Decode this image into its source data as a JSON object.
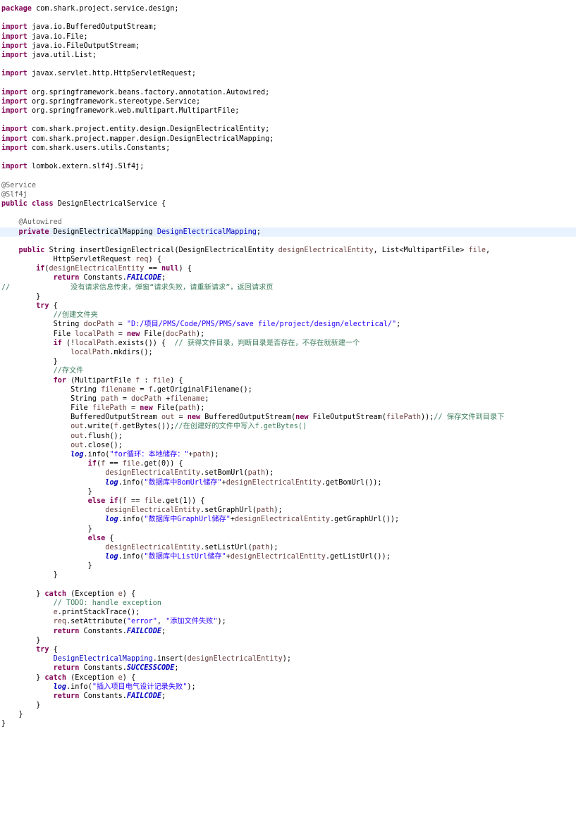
{
  "editor": {
    "language": "java",
    "highlighted_line": 24,
    "colors": {
      "background": "#ffffff",
      "line_highlight": "#e8f2fe",
      "keyword": "#7f0055",
      "annotation": "#646464",
      "comment": "#3f7f5f",
      "string": "#2a00ff",
      "field": "#0000c0",
      "variable": "#6a3e3e"
    },
    "lines": [
      [
        [
          "kw",
          "package"
        ],
        [
          "pl",
          " com.shark.project.service.design;"
        ]
      ],
      [],
      [
        [
          "kw",
          "import"
        ],
        [
          "pl",
          " java.io.BufferedOutputStream;"
        ]
      ],
      [
        [
          "kw",
          "import"
        ],
        [
          "pl",
          " java.io.File;"
        ]
      ],
      [
        [
          "kw",
          "import"
        ],
        [
          "pl",
          " java.io.FileOutputStream;"
        ]
      ],
      [
        [
          "kw",
          "import"
        ],
        [
          "pl",
          " java.util.List;"
        ]
      ],
      [],
      [
        [
          "kw",
          "import"
        ],
        [
          "pl",
          " javax.servlet.http.HttpServletRequest;"
        ]
      ],
      [],
      [
        [
          "kw",
          "import"
        ],
        [
          "pl",
          " org.springframework.beans.factory.annotation.Autowired;"
        ]
      ],
      [
        [
          "kw",
          "import"
        ],
        [
          "pl",
          " org.springframework.stereotype.Service;"
        ]
      ],
      [
        [
          "kw",
          "import"
        ],
        [
          "pl",
          " org.springframework.web.multipart.MultipartFile;"
        ]
      ],
      [],
      [
        [
          "kw",
          "import"
        ],
        [
          "pl",
          " com.shark.project.entity.design.DesignElectricalEntity;"
        ]
      ],
      [
        [
          "kw",
          "import"
        ],
        [
          "pl",
          " com.shark.project.mapper.design.DesignElectricalMapping;"
        ]
      ],
      [
        [
          "kw",
          "import"
        ],
        [
          "pl",
          " com.shark.users.utils.Constants;"
        ]
      ],
      [],
      [
        [
          "kw",
          "import"
        ],
        [
          "pl",
          " lombok.extern.slf4j.Slf4j;"
        ]
      ],
      [],
      [
        [
          "an",
          "@Service"
        ]
      ],
      [
        [
          "an",
          "@Slf4j"
        ]
      ],
      [
        [
          "kw",
          "public"
        ],
        [
          "pl",
          " "
        ],
        [
          "kw",
          "class"
        ],
        [
          "pl",
          " DesignElectricalService {"
        ]
      ],
      [],
      [
        [
          "pl",
          "    "
        ],
        [
          "an",
          "@Autowired"
        ]
      ],
      [
        [
          "pl",
          "    "
        ],
        [
          "kw",
          "private"
        ],
        [
          "pl",
          " DesignElectricalMapping "
        ],
        [
          "fd",
          "DesignElectricalMapping"
        ],
        [
          "pl",
          ";"
        ]
      ],
      [],
      [
        [
          "pl",
          "    "
        ],
        [
          "kw",
          "public"
        ],
        [
          "pl",
          " String insertDesignElectrical(DesignElectricalEntity "
        ],
        [
          "vr",
          "designElectricalEntity"
        ],
        [
          "pl",
          ", List<MultipartFile> "
        ],
        [
          "vr",
          "file"
        ],
        [
          "pl",
          ","
        ]
      ],
      [
        [
          "pl",
          "            HttpServletRequest "
        ],
        [
          "vr",
          "req"
        ],
        [
          "pl",
          ") {"
        ]
      ],
      [
        [
          "pl",
          "        "
        ],
        [
          "kw",
          "if"
        ],
        [
          "pl",
          "("
        ],
        [
          "vr",
          "designElectricalEntity"
        ],
        [
          "pl",
          " == "
        ],
        [
          "kw",
          "null"
        ],
        [
          "pl",
          ") {"
        ]
      ],
      [
        [
          "pl",
          "            "
        ],
        [
          "kw",
          "return"
        ],
        [
          "pl",
          " Constants."
        ],
        [
          "sf",
          "FAILCODE"
        ],
        [
          "pl",
          ";"
        ]
      ],
      [
        [
          "cm",
          "//              没有请求信息传来，弹窗“请求失败，请重新请求”，返回请求页"
        ]
      ],
      [
        [
          "pl",
          "        }"
        ]
      ],
      [
        [
          "pl",
          "        "
        ],
        [
          "kw",
          "try"
        ],
        [
          "pl",
          " {"
        ]
      ],
      [
        [
          "pl",
          "            "
        ],
        [
          "cm",
          "//创建文件夹"
        ]
      ],
      [
        [
          "pl",
          "            String "
        ],
        [
          "vr",
          "docPath"
        ],
        [
          "pl",
          " = "
        ],
        [
          "st",
          "\"D:/项目/PMS/Code/PMS/PMS/save file/project/design/electrical/\""
        ],
        [
          "pl",
          ";"
        ]
      ],
      [
        [
          "pl",
          "            File "
        ],
        [
          "vr",
          "localPath"
        ],
        [
          "pl",
          " = "
        ],
        [
          "kw",
          "new"
        ],
        [
          "pl",
          " File("
        ],
        [
          "vr",
          "docPath"
        ],
        [
          "pl",
          ");"
        ]
      ],
      [
        [
          "pl",
          "            "
        ],
        [
          "kw",
          "if"
        ],
        [
          "pl",
          " (!"
        ],
        [
          "vr",
          "localPath"
        ],
        [
          "pl",
          ".exists()) {  "
        ],
        [
          "cm",
          "// 获得文件目录，判断目录是否存在，不存在就新建一个"
        ]
      ],
      [
        [
          "pl",
          "                "
        ],
        [
          "vr",
          "localPath"
        ],
        [
          "pl",
          ".mkdirs();"
        ]
      ],
      [
        [
          "pl",
          "            }"
        ]
      ],
      [
        [
          "pl",
          "            "
        ],
        [
          "cm",
          "//存文件"
        ]
      ],
      [
        [
          "pl",
          "            "
        ],
        [
          "kw",
          "for"
        ],
        [
          "pl",
          " (MultipartFile "
        ],
        [
          "vr",
          "f"
        ],
        [
          "pl",
          " : "
        ],
        [
          "vr",
          "file"
        ],
        [
          "pl",
          ") {"
        ]
      ],
      [
        [
          "pl",
          "                String "
        ],
        [
          "vr",
          "filename"
        ],
        [
          "pl",
          " = "
        ],
        [
          "vr",
          "f"
        ],
        [
          "pl",
          ".getOriginalFilename();"
        ]
      ],
      [
        [
          "pl",
          "                String "
        ],
        [
          "vr",
          "path"
        ],
        [
          "pl",
          " = "
        ],
        [
          "vr",
          "docPath"
        ],
        [
          "pl",
          " +"
        ],
        [
          "vr",
          "filename"
        ],
        [
          "pl",
          ";"
        ]
      ],
      [
        [
          "pl",
          "                File "
        ],
        [
          "vr",
          "filePath"
        ],
        [
          "pl",
          " = "
        ],
        [
          "kw",
          "new"
        ],
        [
          "pl",
          " File("
        ],
        [
          "vr",
          "path"
        ],
        [
          "pl",
          ");"
        ]
      ],
      [
        [
          "pl",
          "                BufferedOutputStream "
        ],
        [
          "vr",
          "out"
        ],
        [
          "pl",
          " = "
        ],
        [
          "kw",
          "new"
        ],
        [
          "pl",
          " BufferedOutputStream("
        ],
        [
          "kw",
          "new"
        ],
        [
          "pl",
          " FileOutputStream("
        ],
        [
          "vr",
          "filePath"
        ],
        [
          "pl",
          "));"
        ],
        [
          "cm",
          "// 保存文件到目录下"
        ]
      ],
      [
        [
          "pl",
          "                "
        ],
        [
          "vr",
          "out"
        ],
        [
          "pl",
          ".write("
        ],
        [
          "vr",
          "f"
        ],
        [
          "pl",
          ".getBytes());"
        ],
        [
          "cm",
          "//在创建好的文件中写入f.getBytes()"
        ]
      ],
      [
        [
          "pl",
          "                "
        ],
        [
          "vr",
          "out"
        ],
        [
          "pl",
          ".flush();"
        ]
      ],
      [
        [
          "pl",
          "                "
        ],
        [
          "vr",
          "out"
        ],
        [
          "pl",
          ".close();"
        ]
      ],
      [
        [
          "pl",
          "                "
        ],
        [
          "sf",
          "log"
        ],
        [
          "pl",
          ".info("
        ],
        [
          "st",
          "\"for循环：本地储存：\""
        ],
        [
          "pl",
          "+"
        ],
        [
          "vr",
          "path"
        ],
        [
          "pl",
          ");"
        ]
      ],
      [
        [
          "pl",
          "                    "
        ],
        [
          "kw",
          "if"
        ],
        [
          "pl",
          "("
        ],
        [
          "vr",
          "f"
        ],
        [
          "pl",
          " == "
        ],
        [
          "vr",
          "file"
        ],
        [
          "pl",
          ".get(0)) {"
        ]
      ],
      [
        [
          "pl",
          "                        "
        ],
        [
          "vr",
          "designElectricalEntity"
        ],
        [
          "pl",
          ".setBomUrl("
        ],
        [
          "vr",
          "path"
        ],
        [
          "pl",
          ");"
        ]
      ],
      [
        [
          "pl",
          "                        "
        ],
        [
          "sf",
          "log"
        ],
        [
          "pl",
          ".info("
        ],
        [
          "st",
          "\"数据库中BomUrl储存\""
        ],
        [
          "pl",
          "+"
        ],
        [
          "vr",
          "designElectricalEntity"
        ],
        [
          "pl",
          ".getBomUrl());"
        ]
      ],
      [
        [
          "pl",
          "                    }"
        ]
      ],
      [
        [
          "pl",
          "                    "
        ],
        [
          "kw",
          "else"
        ],
        [
          "pl",
          " "
        ],
        [
          "kw",
          "if"
        ],
        [
          "pl",
          "("
        ],
        [
          "vr",
          "f"
        ],
        [
          "pl",
          " == "
        ],
        [
          "vr",
          "file"
        ],
        [
          "pl",
          ".get(1)) {"
        ]
      ],
      [
        [
          "pl",
          "                        "
        ],
        [
          "vr",
          "designElectricalEntity"
        ],
        [
          "pl",
          ".setGraphUrl("
        ],
        [
          "vr",
          "path"
        ],
        [
          "pl",
          ");"
        ]
      ],
      [
        [
          "pl",
          "                        "
        ],
        [
          "sf",
          "log"
        ],
        [
          "pl",
          ".info("
        ],
        [
          "st",
          "\"数据库中GraphUrl储存\""
        ],
        [
          "pl",
          "+"
        ],
        [
          "vr",
          "designElectricalEntity"
        ],
        [
          "pl",
          ".getGraphUrl());"
        ]
      ],
      [
        [
          "pl",
          "                    }"
        ]
      ],
      [
        [
          "pl",
          "                    "
        ],
        [
          "kw",
          "else"
        ],
        [
          "pl",
          " {"
        ]
      ],
      [
        [
          "pl",
          "                        "
        ],
        [
          "vr",
          "designElectricalEntity"
        ],
        [
          "pl",
          ".setListUrl("
        ],
        [
          "vr",
          "path"
        ],
        [
          "pl",
          ");"
        ]
      ],
      [
        [
          "pl",
          "                        "
        ],
        [
          "sf",
          "log"
        ],
        [
          "pl",
          ".info("
        ],
        [
          "st",
          "\"数据库中ListUrl储存\""
        ],
        [
          "pl",
          "+"
        ],
        [
          "vr",
          "designElectricalEntity"
        ],
        [
          "pl",
          ".getListUrl());"
        ]
      ],
      [
        [
          "pl",
          "                    }"
        ]
      ],
      [
        [
          "pl",
          "            }"
        ]
      ],
      [],
      [
        [
          "pl",
          "        } "
        ],
        [
          "kw",
          "catch"
        ],
        [
          "pl",
          " (Exception "
        ],
        [
          "vr",
          "e"
        ],
        [
          "pl",
          ") {"
        ]
      ],
      [
        [
          "pl",
          "            "
        ],
        [
          "cm",
          "// TODO: handle exception"
        ]
      ],
      [
        [
          "pl",
          "            "
        ],
        [
          "vr",
          "e"
        ],
        [
          "pl",
          ".printStackTrace();"
        ]
      ],
      [
        [
          "pl",
          "            "
        ],
        [
          "vr",
          "req"
        ],
        [
          "pl",
          ".setAttribute("
        ],
        [
          "st",
          "\"error\""
        ],
        [
          "pl",
          ", "
        ],
        [
          "st",
          "\"添加文件失败\""
        ],
        [
          "pl",
          ");"
        ]
      ],
      [
        [
          "pl",
          "            "
        ],
        [
          "kw",
          "return"
        ],
        [
          "pl",
          " Constants."
        ],
        [
          "sf",
          "FAILCODE"
        ],
        [
          "pl",
          ";"
        ]
      ],
      [
        [
          "pl",
          "        }"
        ]
      ],
      [
        [
          "pl",
          "        "
        ],
        [
          "kw",
          "try"
        ],
        [
          "pl",
          " {"
        ]
      ],
      [
        [
          "pl",
          "            "
        ],
        [
          "fd",
          "DesignElectricalMapping"
        ],
        [
          "pl",
          ".insert("
        ],
        [
          "vr",
          "designElectricalEntity"
        ],
        [
          "pl",
          ");"
        ]
      ],
      [
        [
          "pl",
          "            "
        ],
        [
          "kw",
          "return"
        ],
        [
          "pl",
          " Constants."
        ],
        [
          "sf",
          "SUCCESSCODE"
        ],
        [
          "pl",
          ";"
        ]
      ],
      [
        [
          "pl",
          "        } "
        ],
        [
          "kw",
          "catch"
        ],
        [
          "pl",
          " (Exception "
        ],
        [
          "vr",
          "e"
        ],
        [
          "pl",
          ") {"
        ]
      ],
      [
        [
          "pl",
          "            "
        ],
        [
          "sf",
          "log"
        ],
        [
          "pl",
          ".info("
        ],
        [
          "st",
          "\"插入项目电气设计记录失败\""
        ],
        [
          "pl",
          ");"
        ]
      ],
      [
        [
          "pl",
          "            "
        ],
        [
          "kw",
          "return"
        ],
        [
          "pl",
          " Constants."
        ],
        [
          "sf",
          "FAILCODE"
        ],
        [
          "pl",
          ";"
        ]
      ],
      [
        [
          "pl",
          "        }"
        ]
      ],
      [
        [
          "pl",
          "    }"
        ]
      ],
      [
        [
          "pl",
          "}"
        ]
      ]
    ]
  }
}
